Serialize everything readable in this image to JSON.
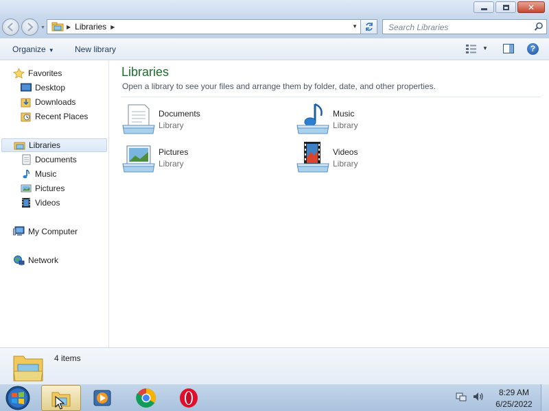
{
  "window": {
    "address": {
      "crumb": "Libraries"
    },
    "search": {
      "placeholder": "Search Libraries"
    }
  },
  "toolbar": {
    "organize_label": "Organize",
    "new_library_label": "New library"
  },
  "sidebar": {
    "favorites": {
      "label": "Favorites",
      "items": [
        {
          "label": "Desktop",
          "icon": "desktop-icon"
        },
        {
          "label": "Downloads",
          "icon": "downloads-icon"
        },
        {
          "label": "Recent Places",
          "icon": "recent-places-icon"
        }
      ]
    },
    "libraries": {
      "label": "Libraries",
      "items": [
        {
          "label": "Documents",
          "icon": "documents-icon"
        },
        {
          "label": "Music",
          "icon": "music-icon"
        },
        {
          "label": "Pictures",
          "icon": "pictures-icon"
        },
        {
          "label": "Videos",
          "icon": "videos-icon"
        }
      ]
    },
    "computer_label": "My Computer",
    "network_label": "Network"
  },
  "content": {
    "title": "Libraries",
    "subtitle": "Open a library to see your files and arrange them by folder, date, and other properties.",
    "libraries": [
      {
        "name": "Documents",
        "kind": "Library",
        "icon": "documents-library-icon"
      },
      {
        "name": "Music",
        "kind": "Library",
        "icon": "music-library-icon"
      },
      {
        "name": "Pictures",
        "kind": "Library",
        "icon": "pictures-library-icon"
      },
      {
        "name": "Videos",
        "kind": "Library",
        "icon": "videos-library-icon"
      }
    ]
  },
  "details": {
    "count_text": "4 items"
  },
  "taskbar": {
    "apps": [
      "windows-explorer-icon",
      "media-player-icon",
      "chrome-icon",
      "opera-icon"
    ],
    "time": "8:29 AM",
    "date": "6/25/2022"
  },
  "colors": {
    "title_green": "#1e6b2d",
    "selection": "#dbe8f7",
    "close_red": "#c7452f"
  }
}
